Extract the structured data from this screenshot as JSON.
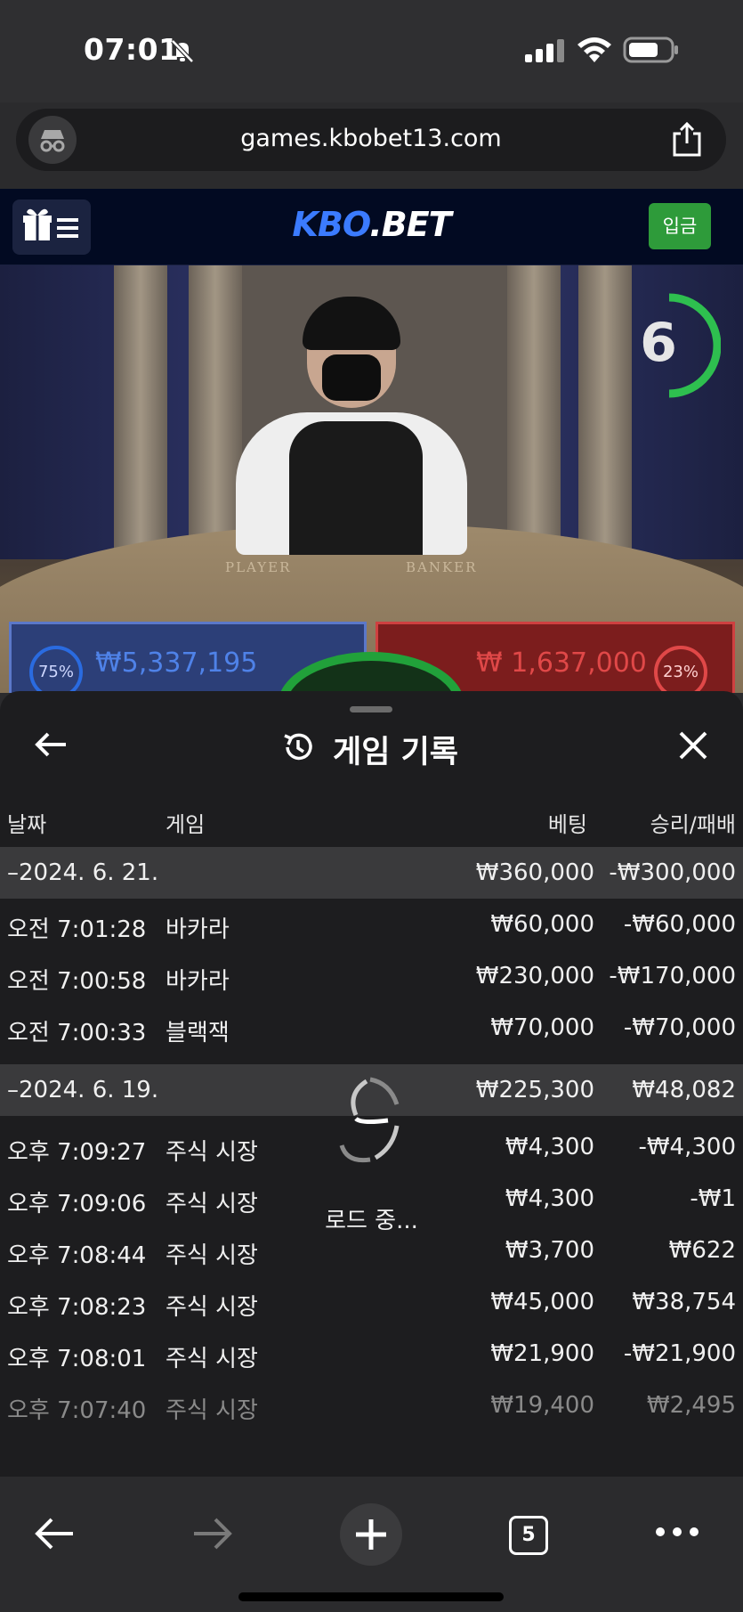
{
  "status_bar": {
    "time": "07:01"
  },
  "browser": {
    "url": "games.kbobet13.com",
    "tab_count": "5"
  },
  "site": {
    "logo_left": "KBO",
    "logo_right": ".BET",
    "deposit_label": "입금"
  },
  "game": {
    "countdown": "6",
    "table_labels": {
      "player": "PLAYER",
      "banker": "BANKER"
    },
    "player": {
      "percent": "75%",
      "amount": "₩5,337,195"
    },
    "banker": {
      "percent": "23%",
      "amount": "₩ 1,637,000"
    }
  },
  "history": {
    "title": "게임 기록",
    "columns": {
      "date": "날짜",
      "game": "게임",
      "bet": "베팅",
      "result": "승리/패배"
    },
    "days": [
      {
        "date": "–2024. 6. 21.",
        "bet": "₩360,000",
        "result": "-₩300,000",
        "rows": [
          {
            "time": "오전 7:01:28",
            "game": "바카라",
            "bet": "₩60,000",
            "result": "-₩60,000"
          },
          {
            "time": "오전 7:00:58",
            "game": "바카라",
            "bet": "₩230,000",
            "result": "-₩170,000"
          },
          {
            "time": "오전 7:00:33",
            "game": "블랙잭",
            "bet": "₩70,000",
            "result": "-₩70,000"
          }
        ]
      },
      {
        "date": "–2024. 6. 19.",
        "bet": "₩225,300",
        "result": "₩48,082",
        "rows": [
          {
            "time": "오후 7:09:27",
            "game": "주식 시장",
            "bet": "₩4,300",
            "result": "-₩4,300"
          },
          {
            "time": "오후 7:09:06",
            "game": "주식 시장",
            "bet": "₩4,300",
            "result": "-₩1"
          },
          {
            "time": "오후 7:08:44",
            "game": "주식 시장",
            "bet": "₩3,700",
            "result": "₩622"
          },
          {
            "time": "오후 7:08:23",
            "game": "주식 시장",
            "bet": "₩45,000",
            "result": "₩38,754"
          },
          {
            "time": "오후 7:08:01",
            "game": "주식 시장",
            "bet": "₩21,900",
            "result": "-₩21,900"
          },
          {
            "time": "오후 7:07:40",
            "game": "주식 시장",
            "bet": "₩19,400",
            "result": "₩2,495"
          }
        ]
      }
    ],
    "loading_text": "로드 중..."
  },
  "colors": {
    "accent_green": "#2e9b3a",
    "brand_blue": "#3b7bff",
    "player_blue": "#2c3f78",
    "banker_red": "#7c1d1d"
  }
}
